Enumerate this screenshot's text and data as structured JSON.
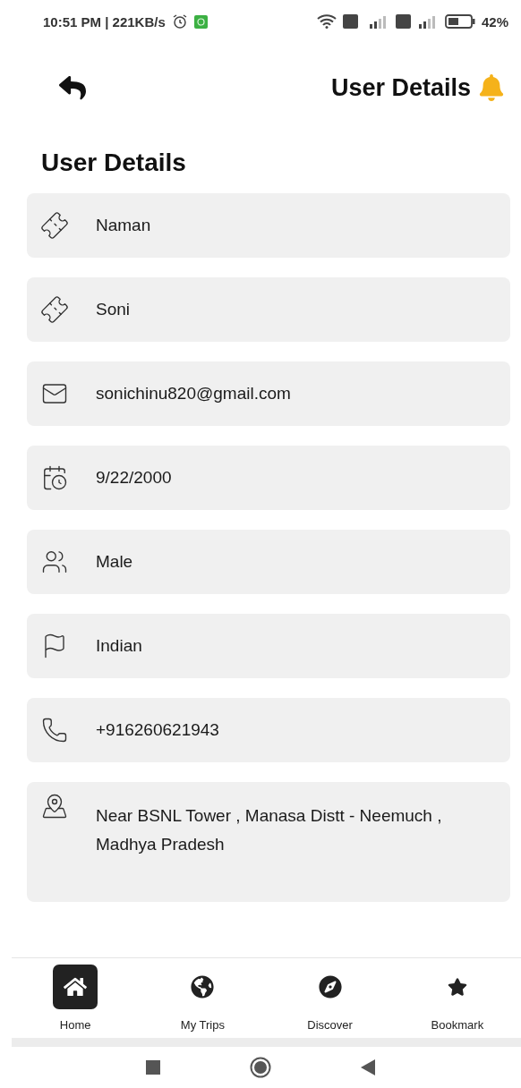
{
  "status_bar": {
    "time": "10:51 PM | 221KB/s",
    "battery_percent": "42%"
  },
  "header": {
    "title": "User Details"
  },
  "section_title": "User Details",
  "fields": [
    {
      "kind": "ticket",
      "value": "Naman"
    },
    {
      "kind": "ticket",
      "value": "Soni"
    },
    {
      "kind": "mail",
      "value": "sonichinu820@gmail.com"
    },
    {
      "kind": "date",
      "value": "9/22/2000"
    },
    {
      "kind": "gender",
      "value": "Male"
    },
    {
      "kind": "flag",
      "value": "Indian"
    },
    {
      "kind": "phone",
      "value": "+916260621943"
    },
    {
      "kind": "address",
      "value": "Near BSNL Tower , Manasa  Distt - Neemuch , Madhya Pradesh"
    }
  ],
  "bottom_nav": [
    {
      "kind": "home",
      "label": "Home",
      "selected": true
    },
    {
      "kind": "trips",
      "label": "My Trips",
      "selected": false
    },
    {
      "kind": "discover",
      "label": "Discover",
      "selected": false
    },
    {
      "kind": "bookmark",
      "label": "Bookmark",
      "selected": false
    }
  ]
}
